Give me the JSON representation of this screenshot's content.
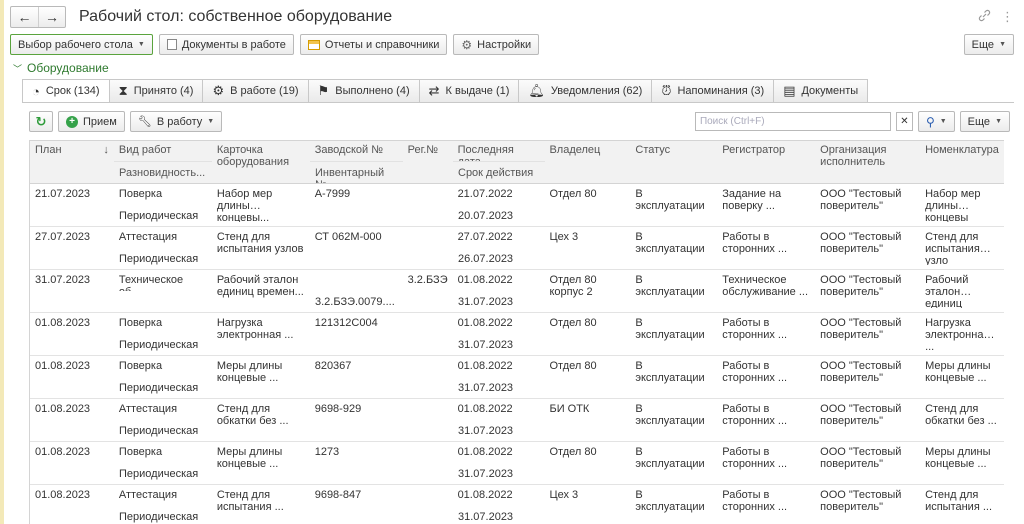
{
  "window": {
    "title": "Рабочий стол: собственное оборудование",
    "nav_back": "←",
    "nav_forward": "→",
    "link_icon": "🔗",
    "menu_icon": "⋮"
  },
  "command_bar": {
    "workspace_select": "Выбор рабочего стола",
    "docs_in_work": "Документы в работе",
    "reports": "Отчеты и справочники",
    "settings": "Настройки",
    "more": "Еще"
  },
  "group": {
    "title": "Оборудование"
  },
  "tabs": [
    {
      "label": "Срок (134)",
      "icon": "clock-icon"
    },
    {
      "label": "Принято (4)",
      "icon": "hourglass-icon"
    },
    {
      "label": "В работе (19)",
      "icon": "gear-icon"
    },
    {
      "label": "Выполнено (4)",
      "icon": "flag-icon"
    },
    {
      "label": "К выдаче (1)",
      "icon": "handover-icon"
    },
    {
      "label": "Уведомления (62)",
      "icon": "bell-icon"
    },
    {
      "label": "Напоминания (3)",
      "icon": "alarm-icon"
    },
    {
      "label": "Документы",
      "icon": "document-icon"
    }
  ],
  "table_toolbar": {
    "accept": "Прием",
    "to_work": "В работу",
    "search_placeholder": "Поиск (Ctrl+F)",
    "more": "Еще"
  },
  "columns": {
    "plan": "План",
    "work_type": "Вид работ",
    "work_subtype": "Разновидность...",
    "card": "Карточка оборудования",
    "serial": "Заводской №",
    "inventory": "Инвентарный №",
    "reg": "Рег.№",
    "last_date": "Последняя дата",
    "valid_until": "Срок действия",
    "owner": "Владелец",
    "status": "Статус",
    "registrar": "Регистратор",
    "org": "Организация исполнитель",
    "nomenclature": "Номенклатура"
  },
  "rows": [
    {
      "plan": "21.07.2023",
      "work": "Поверка",
      "sub": "Периодическая",
      "card": "Набор мер длины концевы...",
      "serial": "А-7999",
      "inv": "",
      "reg": "",
      "last": "21.07.2022",
      "valid": "20.07.2023",
      "owner": "Отдел 80",
      "status": "В эксплуатации",
      "registrar": "Задание на поверку ...",
      "org": "ООО \"Тестовый поверитель\"",
      "nom": "Набор мер длины концевы"
    },
    {
      "plan": "27.07.2023",
      "work": "Аттестация",
      "sub": "Периодическая",
      "card": "Стенд для испытания узлов",
      "serial": "СТ 062М-000",
      "inv": "",
      "reg": "",
      "last": "27.07.2022",
      "valid": "26.07.2023",
      "owner": "Цех 3",
      "status": "В эксплуатации",
      "registrar": "Работы в сторонних ...",
      "org": "ООО \"Тестовый поверитель\"",
      "nom": "Стенд для испытания узло"
    },
    {
      "plan": "31.07.2023",
      "work": "Техническое об...",
      "sub": "",
      "card": "Рабочий эталон единиц времен...",
      "serial": "",
      "inv": "3.2.БЗЭ.0079....",
      "reg": "3.2.БЗЭ",
      "last": "01.08.2022",
      "valid": "31.07.2023",
      "owner": "Отдел 80 корпус 2",
      "status": "В эксплуатации",
      "registrar": "Техническое обслуживание ...",
      "org": "ООО \"Тестовый поверитель\"",
      "nom": "Рабочий эталон единиц времен..."
    },
    {
      "plan": "01.08.2023",
      "work": "Поверка",
      "sub": "Периодическая",
      "card": "Нагрузка электронная ...",
      "serial": "121312С004",
      "inv": "",
      "reg": "",
      "last": "01.08.2022",
      "valid": "31.07.2023",
      "owner": "Отдел 80",
      "status": "В эксплуатации",
      "registrar": "Работы в сторонних ...",
      "org": "ООО \"Тестовый поверитель\"",
      "nom": "Нагрузка электронная ..."
    },
    {
      "plan": "01.08.2023",
      "work": "Поверка",
      "sub": "Периодическая",
      "card": "Меры длины концевые ...",
      "serial": "820367",
      "inv": "",
      "reg": "",
      "last": "01.08.2022",
      "valid": "31.07.2023",
      "owner": "Отдел 80",
      "status": "В эксплуатации",
      "registrar": "Работы в сторонних ...",
      "org": "ООО \"Тестовый поверитель\"",
      "nom": "Меры длины концевые ..."
    },
    {
      "plan": "01.08.2023",
      "work": "Аттестация",
      "sub": "Периодическая",
      "card": "Стенд для обкатки без ...",
      "serial": "9698-929",
      "inv": "",
      "reg": "",
      "last": "01.08.2022",
      "valid": "31.07.2023",
      "owner": "БИ ОТК",
      "status": "В эксплуатации",
      "registrar": "Работы в сторонних ...",
      "org": "ООО \"Тестовый поверитель\"",
      "nom": "Стенд для обкатки без ..."
    },
    {
      "plan": "01.08.2023",
      "work": "Поверка",
      "sub": "Периодическая",
      "card": "Меры длины концевые ...",
      "serial": "1273",
      "inv": "",
      "reg": "",
      "last": "01.08.2022",
      "valid": "31.07.2023",
      "owner": "Отдел 80",
      "status": "В эксплуатации",
      "registrar": "Работы в сторонних ...",
      "org": "ООО \"Тестовый поверитель\"",
      "nom": "Меры длины концевые ..."
    },
    {
      "plan": "01.08.2023",
      "work": "Аттестация",
      "sub": "Периодическая",
      "card": "Стенд для испытания ...",
      "serial": "9698-847",
      "inv": "",
      "reg": "",
      "last": "01.08.2022",
      "valid": "31.07.2023",
      "owner": "Цех 3",
      "status": "В эксплуатации",
      "registrar": "Работы в сторонних ...",
      "org": "ООО \"Тестовый поверитель\"",
      "nom": "Стенд для испытания ..."
    }
  ]
}
